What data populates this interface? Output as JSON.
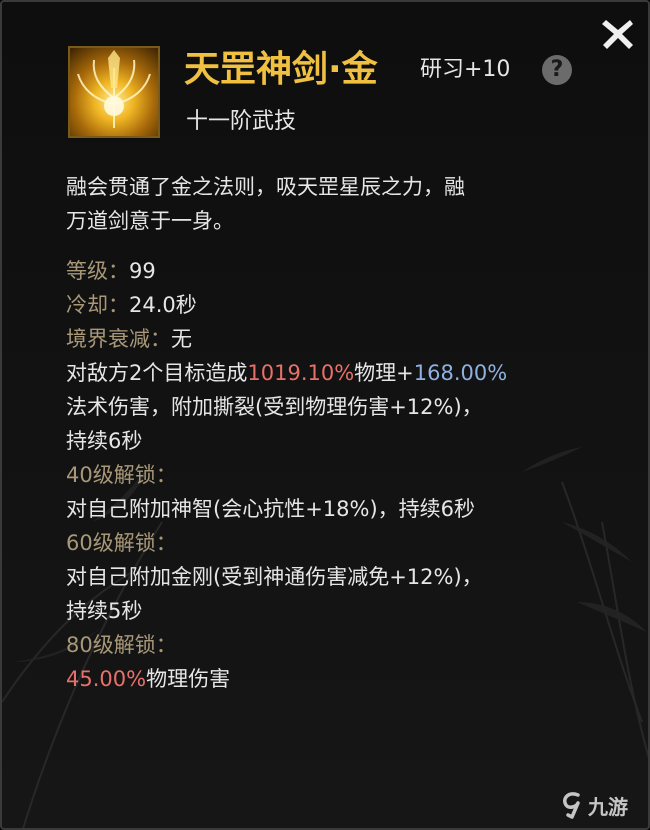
{
  "skill": {
    "name": "天罡神剑·金",
    "research": "研习+10",
    "tier": "十一阶武技",
    "description_lines": [
      "融会贯通了金之法则，吸天罡星辰之力，融",
      "万道剑意于一身。"
    ]
  },
  "help_label": "?",
  "stats": {
    "level_label": "等级：",
    "level_value": "99",
    "cooldown_label": "冷却：",
    "cooldown_value": "24.0秒",
    "decay_label": "境界衰减：",
    "decay_value": "无"
  },
  "effect": {
    "line1_prefix": "对敌方2个目标造成",
    "line1_pct1": "1019.10%",
    "line1_mid": "物理+",
    "line1_pct2": "168.00%",
    "line2": "法术伤害，附加撕裂(受到物理伤害+12%)，",
    "line3": "持续6秒"
  },
  "unlocks": [
    {
      "label": "40级解锁：",
      "lines": [
        "对自己附加神智(会心抗性+18%)，持续6秒"
      ]
    },
    {
      "label": "60级解锁：",
      "lines": [
        "对自己附加金刚(受到神通伤害减免+12%)，",
        "持续5秒"
      ]
    },
    {
      "label": "80级解锁：",
      "pct": "45.00%",
      "suffix": "物理伤害"
    }
  ],
  "watermark": "九游",
  "icons": {
    "close": "close-icon",
    "help": "help-icon",
    "skill": "golden-sword-skill-icon",
    "watermark_logo": "jiuyou-logo-icon"
  },
  "colors": {
    "title": "#f0c040",
    "label": "#a89878",
    "damage_red": "#e8706a",
    "damage_blue": "#8fb0e0",
    "text": "#e6e6e6"
  }
}
